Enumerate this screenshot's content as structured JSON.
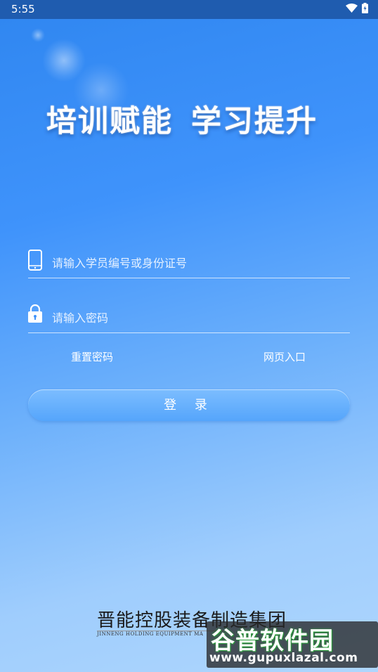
{
  "status_bar": {
    "time": "5:55"
  },
  "hero": {
    "part1": "培训赋能",
    "part2": "学习提升"
  },
  "form": {
    "account_placeholder": "请输入学员编号或身份证号",
    "password_placeholder": "请输入密码"
  },
  "links": {
    "reset_password": "重置密码",
    "web_entry": "网页入口"
  },
  "login_button": "登 录",
  "company": {
    "name_cn": "晋能控股装备制造集团",
    "name_en": "JINNENG HOLDING EQUIPMENT MA"
  },
  "watermark": {
    "title": "谷普软件园",
    "url": "www.gupuxlazal.com"
  },
  "colors": {
    "status_bar": "#1f5caf",
    "accent": "#3f93fb",
    "button": "#6ab3fe"
  }
}
